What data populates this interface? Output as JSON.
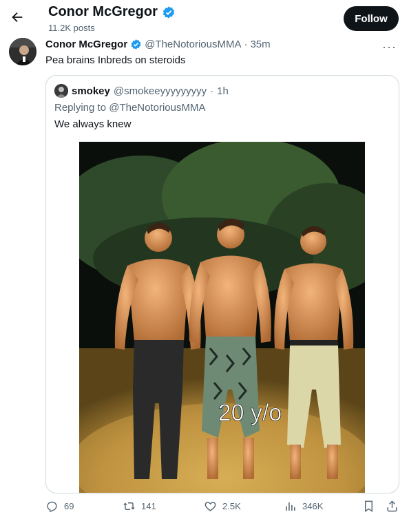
{
  "header": {
    "title": "Conor McGregor",
    "posts": "11.2K posts",
    "follow_label": "Follow"
  },
  "tweet": {
    "author_name": "Conor McGregor",
    "handle": "@TheNotoriousMMA",
    "separator": "·",
    "time": "35m",
    "more": "···",
    "text": "Pea brains Inbreds on steroids"
  },
  "quote": {
    "author_name": "smokey",
    "handle": "@smokeeyyyyyyyyy",
    "separator": "·",
    "time": "1h",
    "replying": "Replying to @TheNotoriousMMA",
    "text": "We always knew",
    "image_caption": "20 y/o"
  },
  "actions": {
    "replies": "69",
    "reposts": "141",
    "likes": "2.5K",
    "views": "346K"
  },
  "colors": {
    "accent": "#1d9bf0",
    "text": "#0f1419",
    "secondary": "#536471",
    "border": "#cfd9de"
  }
}
